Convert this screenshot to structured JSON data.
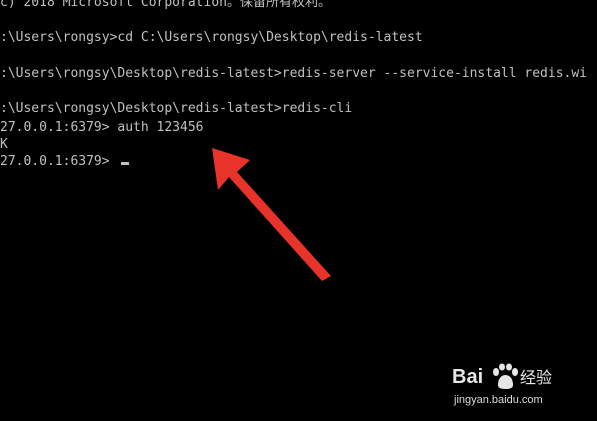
{
  "terminal": {
    "lines": [
      "c) 2018 Microsoft Corporation。保留所有权利。",
      ":\\Users\\rongsy>cd C:\\Users\\rongsy\\Desktop\\redis-latest",
      ":\\Users\\rongsy\\Desktop\\redis-latest>redis-server --service-install redis.wi",
      ":\\Users\\rongsy\\Desktop\\redis-latest>redis-cli",
      "27.0.0.1:6379> auth 123456",
      "K",
      "27.0.0.1:6379> "
    ]
  },
  "colors": {
    "background": "#000000",
    "text": "#c0c0c0",
    "arrow": "#e8332b"
  },
  "watermark": {
    "logo_text": "Bai 经验",
    "url": "jingyan.baidu.com"
  }
}
